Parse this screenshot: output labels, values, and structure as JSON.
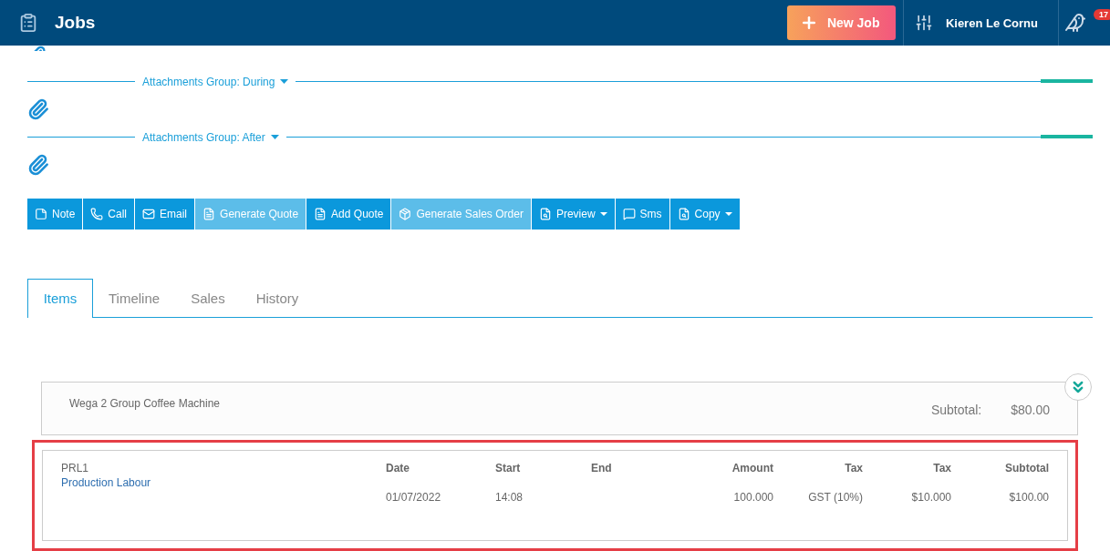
{
  "header": {
    "title": "Jobs",
    "new_button": "New Job",
    "user": "Kieren Le Cornu",
    "badge": "17"
  },
  "attachment_groups": [
    {
      "label": "Attachments Group: During"
    },
    {
      "label": "Attachments Group: After"
    }
  ],
  "actions": [
    {
      "label": "Note",
      "disabled": false,
      "dropdown": false
    },
    {
      "label": "Call",
      "disabled": false,
      "dropdown": false
    },
    {
      "label": "Email",
      "disabled": false,
      "dropdown": false
    },
    {
      "label": "Generate Quote",
      "disabled": true,
      "dropdown": false
    },
    {
      "label": "Add Quote",
      "disabled": false,
      "dropdown": false
    },
    {
      "label": "Generate Sales Order",
      "disabled": true,
      "dropdown": false
    },
    {
      "label": "Preview",
      "disabled": false,
      "dropdown": true
    },
    {
      "label": "Sms",
      "disabled": false,
      "dropdown": false
    },
    {
      "label": "Copy",
      "disabled": false,
      "dropdown": true
    }
  ],
  "tabs": [
    {
      "label": "Items",
      "selected": true
    },
    {
      "label": "Timeline",
      "selected": false
    },
    {
      "label": "Sales",
      "selected": false
    },
    {
      "label": "History",
      "selected": false
    }
  ],
  "item_group": {
    "name": "Wega 2 Group Coffee Machine",
    "subtotal_label": "Subtotal:",
    "subtotal": "$80.00"
  },
  "line_item": {
    "highlighted": true,
    "code": "PRL1",
    "name": "Production Labour",
    "columns": [
      {
        "heading": "Date",
        "value": "01/07/2022"
      },
      {
        "heading": "Start",
        "value": "14:08"
      },
      {
        "heading": "End"
      },
      {
        "heading": "Amount",
        "value": "100.000"
      },
      {
        "heading": "Tax",
        "value": "GST (10%)"
      },
      {
        "heading": "Tax",
        "value": "$10.000"
      },
      {
        "heading": "Subtotal",
        "value": "$100.00"
      }
    ]
  }
}
